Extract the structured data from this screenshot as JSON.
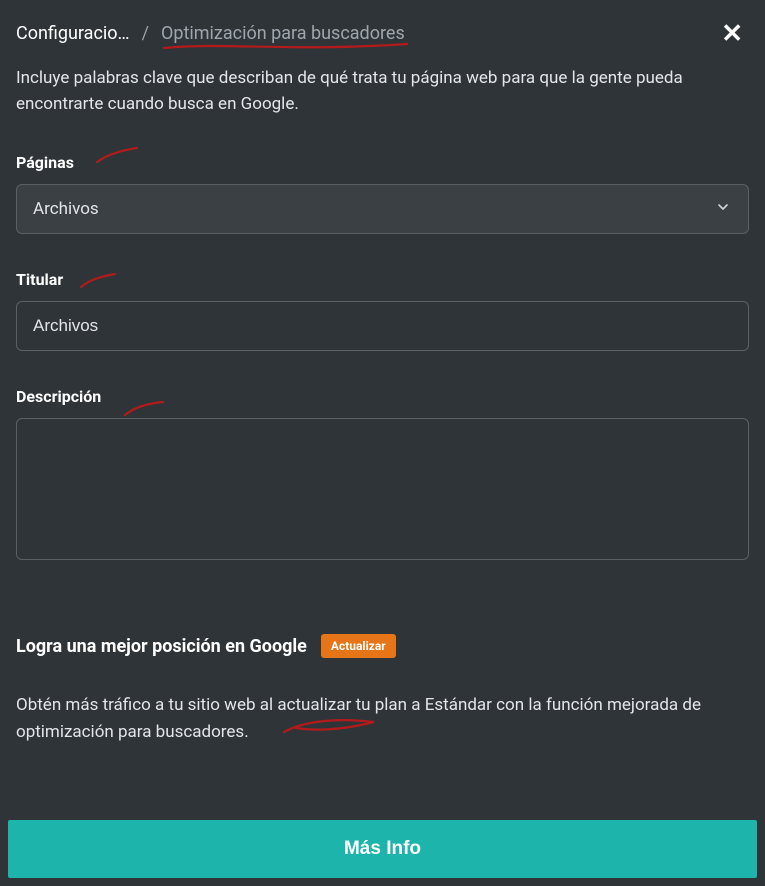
{
  "breadcrumb": {
    "root": "Configuracio…",
    "sep": "/",
    "current": "Optimización para buscadores"
  },
  "intro": "Incluye palabras clave que describan de qué trata tu página web para que la gente pueda encontrarte cuando busca en Google.",
  "form": {
    "pages": {
      "label": "Páginas",
      "value": "Archivos"
    },
    "title": {
      "label": "Titular",
      "value": "Archivos"
    },
    "description": {
      "label": "Descripción",
      "value": ""
    }
  },
  "upgrade": {
    "heading": "Logra una mejor posición en Google",
    "badge": "Actualizar",
    "desc": "Obtén más tráfico a tu sitio web al actualizar tu plan a Estándar con la función mejorada de optimización para buscadores."
  },
  "cta": "Más Info"
}
